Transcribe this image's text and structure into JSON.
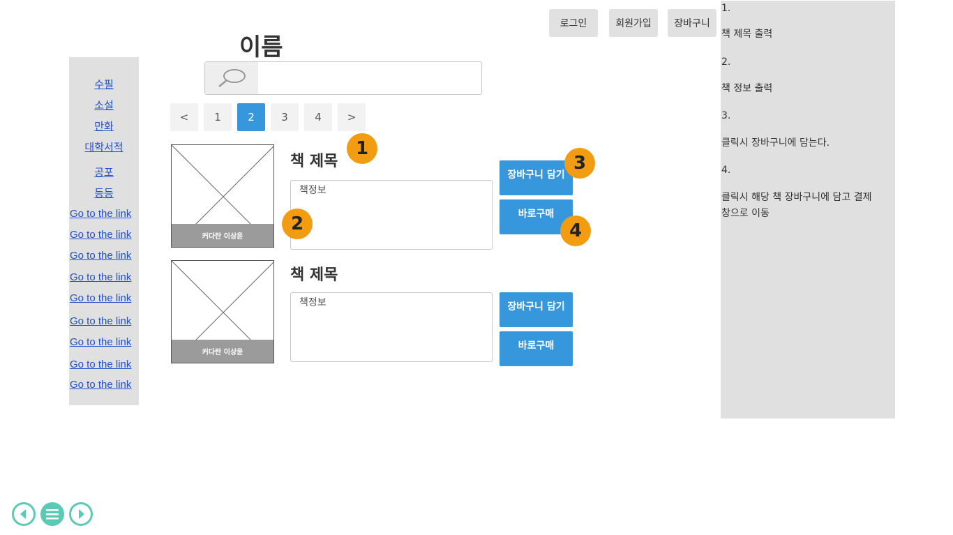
{
  "header": {
    "login_label": "로그인",
    "signup_label": "회원가입",
    "cart_label": "장바구니",
    "site_title": "이름"
  },
  "search": {
    "placeholder": "",
    "value": "",
    "icon": "search-icon"
  },
  "sidebar": {
    "categories": [
      "수필",
      "소설",
      "만화",
      "대학서적",
      "공포",
      "등등"
    ],
    "links": [
      "Go to the link",
      "Go to the link",
      "Go to the link",
      "Go to the link",
      "Go to the link",
      "Go to the link",
      "Go to the link",
      "Go to the link",
      "Go to the link"
    ]
  },
  "pagination": {
    "prev": "<",
    "pages": [
      "1",
      "2",
      "3",
      "4"
    ],
    "active_page": "2",
    "next": ">"
  },
  "books": [
    {
      "title": "책 제목",
      "info": "책정보",
      "image_caption": "커다란 이상윤",
      "cart_button": "장바구니 담기",
      "buy_button": "바로구매"
    },
    {
      "title": "책 제목",
      "info": "책정보",
      "image_caption": "커다란 이상윤",
      "cart_button": "장바구니 담기",
      "buy_button": "바로구매"
    }
  ],
  "badges": [
    "1",
    "2",
    "3",
    "4"
  ],
  "description": {
    "lines": [
      "1.",
      "책 제목 출력",
      "2.",
      "책 정보 출력",
      "3.",
      "클릭시 장바구니에 담는다.",
      "4.",
      "클릭시 해당 책 장바구니에 담고 결제",
      "창으로 이동"
    ]
  },
  "bottom_nav": {
    "prev_icon": "circle-left-arrow-icon",
    "menu_icon": "circle-menu-icon",
    "next_icon": "circle-right-arrow-icon"
  },
  "colors": {
    "accent": "#3797dc",
    "badge": "#f29c12",
    "panel": "#e0e0e0",
    "nav": "#5cc9b5",
    "link": "#1f4fcc"
  }
}
